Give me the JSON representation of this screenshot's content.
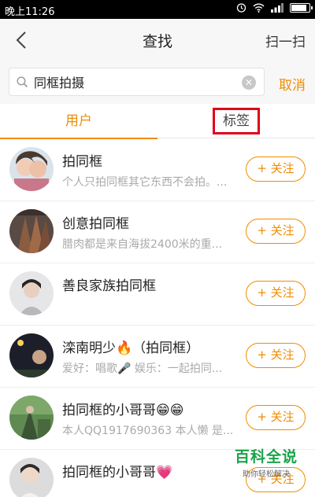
{
  "status_bar": {
    "time": "晚上11:26"
  },
  "header": {
    "title": "查找",
    "scan_label": "扫一扫"
  },
  "search": {
    "value": "同框拍摄",
    "cancel_label": "取消"
  },
  "tabs": [
    {
      "label": "用户",
      "active": true
    },
    {
      "label": "标签",
      "active": false,
      "highlighted": true
    }
  ],
  "users": [
    {
      "name": "拍同框",
      "desc": "个人只拍同框其它东西不会拍。..."
    },
    {
      "name": "创意拍同框",
      "desc": "腊肉都是来自海拔2400米的重..."
    },
    {
      "name": "善良家族拍同框",
      "desc": ""
    },
    {
      "name": "滦南明少🔥（拍同框）",
      "desc": "爱好：唱歌🎤 娱乐：一起拍同..."
    },
    {
      "name": "拍同框的小哥哥😁😁",
      "desc": "本人QQ1917690363 本人懒 是..."
    },
    {
      "name": "拍同框的小哥哥💗",
      "desc": ""
    }
  ],
  "follow_label": "+ 关注",
  "watermark": {
    "title": "百科全说",
    "subtitle": "助你轻松解决"
  },
  "colors": {
    "accent": "#f08c00",
    "highlight_box": "#e0001b",
    "watermark": "#1aa34a"
  }
}
